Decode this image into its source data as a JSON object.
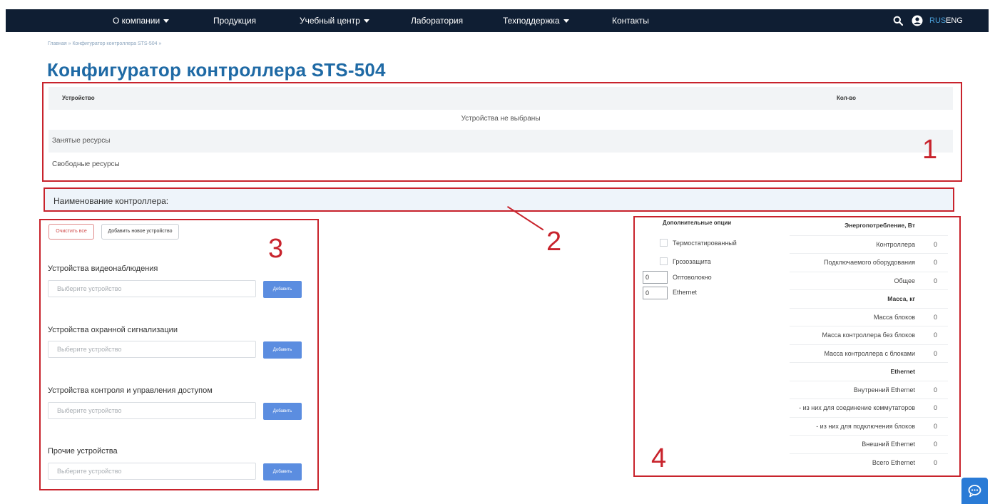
{
  "nav": {
    "items": [
      {
        "label": "О компании",
        "has_dropdown": true
      },
      {
        "label": "Продукция",
        "has_dropdown": false
      },
      {
        "label": "Учебный центр",
        "has_dropdown": true
      },
      {
        "label": "Лаборатория",
        "has_dropdown": false
      },
      {
        "label": "Техподдержка",
        "has_dropdown": true
      },
      {
        "label": "Контакты",
        "has_dropdown": false
      }
    ],
    "lang_rus": "RUS",
    "lang_eng": "ENG",
    "search_icon": "search-icon",
    "user_icon": "user-circle-icon"
  },
  "breadcrumb": {
    "home": "Главная",
    "current": "Конфигуратор контроллера STS-504"
  },
  "page_title": "Конфигуратор контроллера STS-504",
  "devices_table": {
    "col_device": "Устройство",
    "col_qty": "Кол-во",
    "empty_text": "Устройства не выбраны",
    "busy_resources": "Занятые ресурсы",
    "free_resources": "Свободные ресурсы"
  },
  "controller_name_label": "Наименование контроллера:",
  "device_panel": {
    "clear_all": "Очистить все",
    "add_new_device": "Добавить новое устройство",
    "categories": [
      {
        "label": "Устройства видеонаблюдения",
        "placeholder": "Выберите устройство",
        "add_label": "Добавить"
      },
      {
        "label": "Устройства охранной сигнализации",
        "placeholder": "Выберите устройство",
        "add_label": "Добавить"
      },
      {
        "label": "Устройства контроля и управления доступом",
        "placeholder": "Выберите устройство",
        "add_label": "Добавить"
      },
      {
        "label": "Прочие устройства",
        "placeholder": "Выберите устройство",
        "add_label": "Добавить"
      }
    ]
  },
  "options_panel": {
    "header": "Дополнительные опции",
    "checkboxes": [
      {
        "label": "Термостатированный",
        "checked": false
      },
      {
        "label": "Грозозащита",
        "checked": false
      }
    ],
    "counters": [
      {
        "label": "Оптоволокно",
        "value": "0"
      },
      {
        "label": "Ethernet",
        "value": "0"
      }
    ]
  },
  "stats": {
    "rows": [
      {
        "label": "Энергопотребление, Вт",
        "header": true
      },
      {
        "label": "Контроллера",
        "value": "0"
      },
      {
        "label": "Подключаемого оборудования",
        "value": "0"
      },
      {
        "label": "Общее",
        "value": "0"
      },
      {
        "label": "Масса, кг",
        "header": true
      },
      {
        "label": "Масса блоков",
        "value": "0"
      },
      {
        "label": "Масса контроллера без блоков",
        "value": "0"
      },
      {
        "label": "Масса контроллера с блоками",
        "value": "0"
      },
      {
        "label": "Ethernet",
        "header": true
      },
      {
        "label": "Внутренний Ethernet",
        "value": "0"
      },
      {
        "label": "- из них для соединение коммутаторов",
        "value": "0"
      },
      {
        "label": "- из них для подключения блоков",
        "value": "0"
      },
      {
        "label": "Внешний Ethernet",
        "value": "0"
      },
      {
        "label": "Всего Ethernet",
        "value": "0"
      }
    ]
  },
  "annotations": [
    "1",
    "2",
    "3",
    "4"
  ],
  "colors": {
    "navbar": "#0f1e33",
    "title": "#1f6aa5",
    "annotation_red": "#c8232c",
    "add_button": "#5b8de0",
    "chat_button": "#2a7bd6"
  },
  "chat_icon": "chat-bubble-icon"
}
